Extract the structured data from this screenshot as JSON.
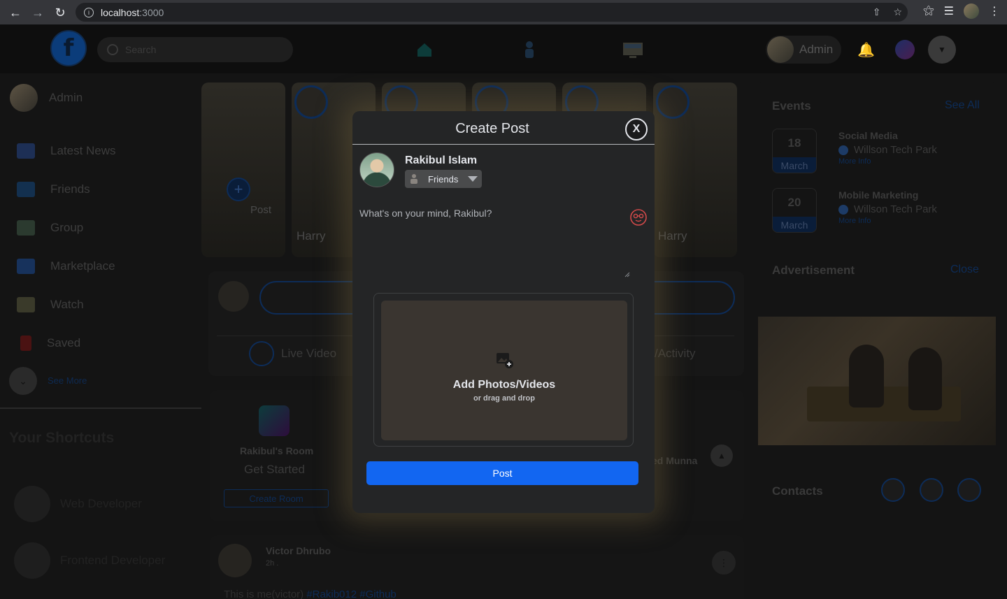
{
  "browser": {
    "url_host": "localhost",
    "url_port": ":3000"
  },
  "header": {
    "logo_letter": "f",
    "search_placeholder": "Search",
    "profile_name": "Admin"
  },
  "left_sidebar": {
    "user_name": "Admin",
    "items": [
      {
        "label": "Latest News",
        "icon": "news-icon",
        "color": "#1d2f55"
      },
      {
        "label": "Friends",
        "icon": "friends-icon",
        "color": "#13304f"
      },
      {
        "label": "Group",
        "icon": "group-icon",
        "color": "#2b3a2f"
      },
      {
        "label": "Marketplace",
        "icon": "marketplace-icon",
        "color": "#17325c"
      },
      {
        "label": "Watch",
        "icon": "watch-icon",
        "color": "#3a3a2a"
      },
      {
        "label": "Saved",
        "icon": "saved-icon",
        "color": "#4a1212"
      }
    ],
    "see_more": "See More",
    "shortcuts_title": "Your Shortcuts",
    "shortcuts": [
      {
        "label": "Web Developer"
      },
      {
        "label": "Frontend Developer"
      }
    ]
  },
  "stories": {
    "create_label": "Post",
    "items": [
      {
        "name": "Harry"
      },
      {
        "name": ""
      },
      {
        "name": ""
      },
      {
        "name": ""
      },
      {
        "name": "Harry"
      }
    ]
  },
  "composer": {
    "live_video_label": "Live Video",
    "activity_label": "/Activity"
  },
  "rooms": {
    "room_name": "Rakibul's Room",
    "get_started": "Get Started",
    "create_room": "Create Room",
    "partial_name": "ed Munna"
  },
  "feed_post": {
    "author": "Victor Dhrubo",
    "time": "2h .",
    "text": "This is me(victor)",
    "tags": "#Rakib012 #Github"
  },
  "right_sidebar": {
    "events_title": "Events",
    "see_all": "See All",
    "events": [
      {
        "day": "18",
        "month": "March",
        "title": "Social Media",
        "location": "Willson Tech Park",
        "more": "More Info"
      },
      {
        "day": "20",
        "month": "March",
        "title": "Mobile Marketing",
        "location": "Willson Tech Park",
        "more": "More Info"
      }
    ],
    "ad_title": "Advertisement",
    "ad_close": "Close",
    "contacts_title": "Contacts"
  },
  "modal": {
    "title": "Create Post",
    "close_label": "X",
    "user_name": "Rakibul Islam",
    "audience": "Friends",
    "placeholder": "What's on your mind, Rakibul?",
    "upload_title": "Add Photos/Videos",
    "upload_subtitle": "or drag and drop",
    "post_button": "Post",
    "post_button_color": "#1266f1"
  }
}
